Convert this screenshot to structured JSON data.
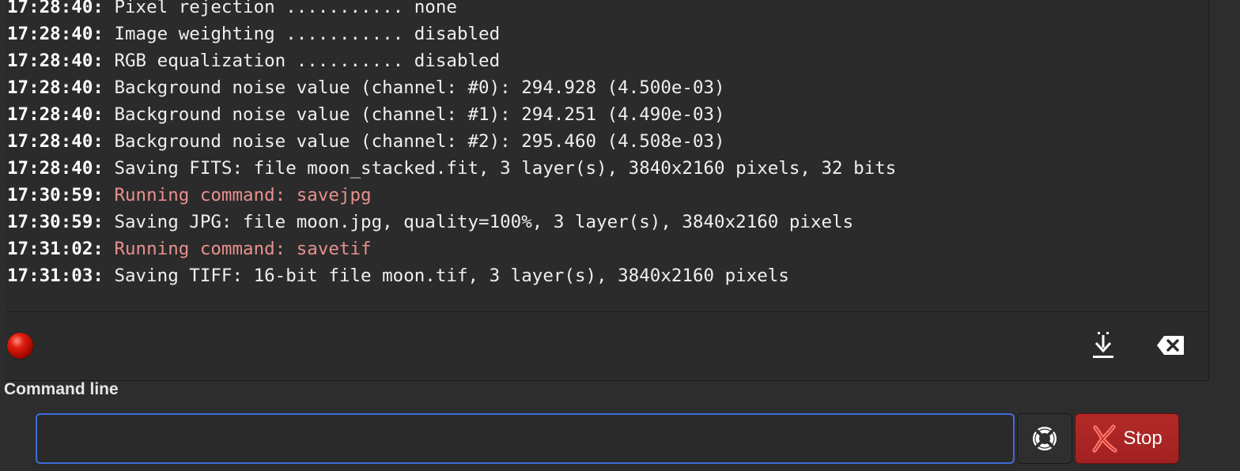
{
  "console": {
    "lines": [
      {
        "time": "17:28:40:",
        "msg": "Pixel rejection ........... none",
        "kind": "info"
      },
      {
        "time": "17:28:40:",
        "msg": "Image weighting ........... disabled",
        "kind": "info"
      },
      {
        "time": "17:28:40:",
        "msg": "RGB equalization .......... disabled",
        "kind": "info"
      },
      {
        "time": "17:28:40:",
        "msg": "Background noise value (channel: #0): 294.928 (4.500e-03)",
        "kind": "info"
      },
      {
        "time": "17:28:40:",
        "msg": "Background noise value (channel: #1): 294.251 (4.490e-03)",
        "kind": "info"
      },
      {
        "time": "17:28:40:",
        "msg": "Background noise value (channel: #2): 295.460 (4.508e-03)",
        "kind": "info"
      },
      {
        "time": "17:28:40:",
        "msg": "Saving FITS: file moon_stacked.fit, 3 layer(s), 3840x2160 pixels, 32 bits",
        "kind": "info"
      },
      {
        "time": "17:30:59:",
        "msg": "Running command: savejpg",
        "kind": "cmd"
      },
      {
        "time": "17:30:59:",
        "msg": "Saving JPG: file moon.jpg, quality=100%, 3 layer(s), 3840x2160 pixels",
        "kind": "info"
      },
      {
        "time": "17:31:02:",
        "msg": "Running command: savetif",
        "kind": "cmd"
      },
      {
        "time": "17:31:03:",
        "msg": "Saving TIFF: 16-bit file moon.tif, 3 layer(s), 3840x2160 pixels",
        "kind": "info"
      }
    ]
  },
  "toolbar": {
    "status_led_color": "#d01808",
    "save_log_icon": "download-to-bottom-icon",
    "clear_log_icon": "backspace-clear-icon"
  },
  "command_line": {
    "label": "Command line",
    "value": "",
    "help_icon": "lifebuoy-help-icon",
    "stop_label": "Stop",
    "stop_icon": "red-x-icon"
  },
  "colors": {
    "command_text": "#e8908e",
    "input_focus_border": "#3d6ed8",
    "stop_button": "#a82523"
  }
}
